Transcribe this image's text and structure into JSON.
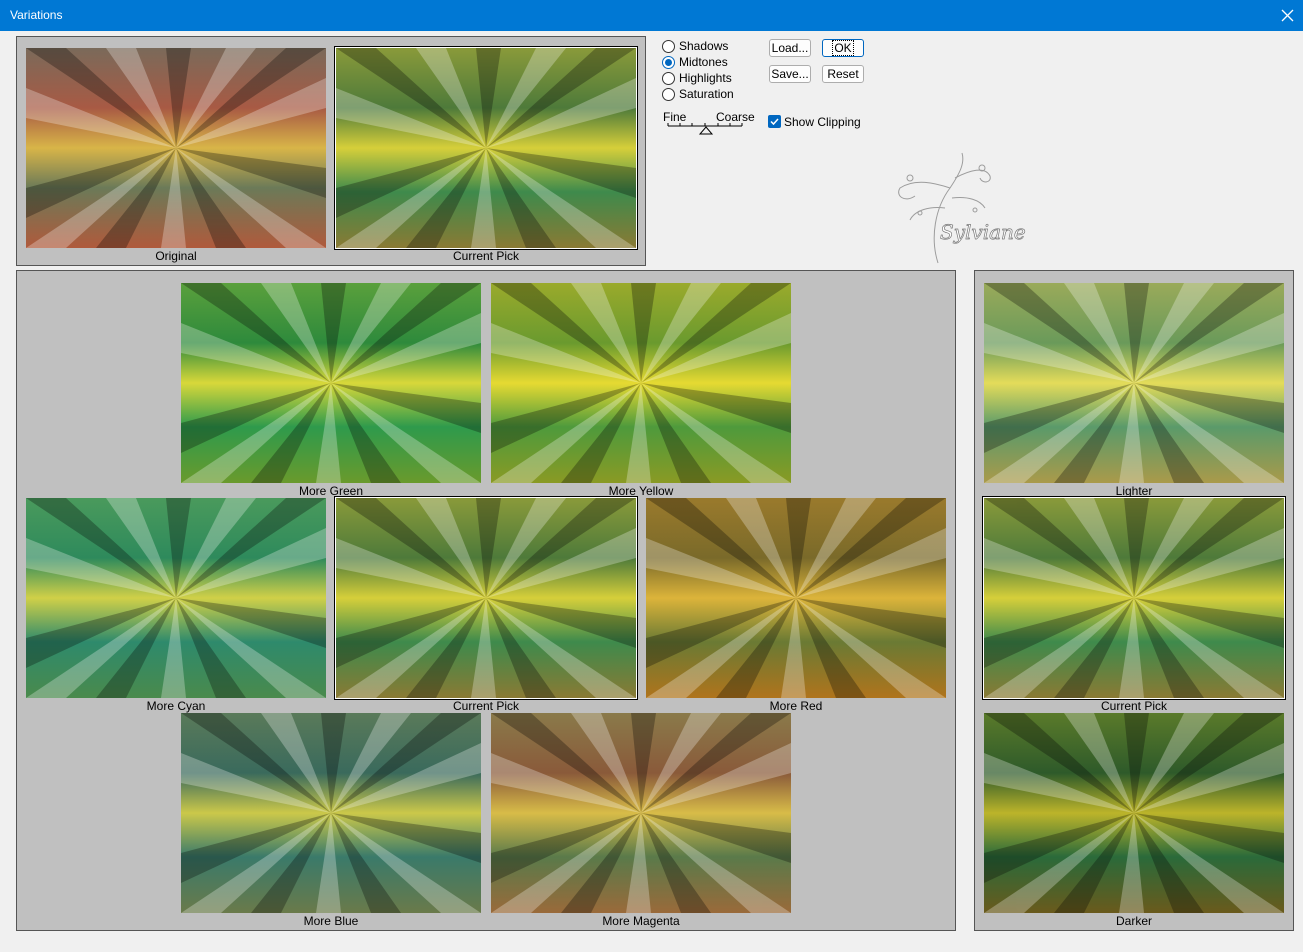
{
  "window": {
    "title": "Variations"
  },
  "top_thumbs": {
    "original": "Original",
    "current_pick": "Current Pick"
  },
  "tone_options": [
    {
      "label": "Shadows",
      "checked": false
    },
    {
      "label": "Midtones",
      "checked": true
    },
    {
      "label": "Highlights",
      "checked": false
    },
    {
      "label": "Saturation",
      "checked": false
    }
  ],
  "slider": {
    "left_label": "Fine",
    "right_label": "Coarse"
  },
  "buttons": {
    "load": "Load...",
    "ok": "OK",
    "save": "Save...",
    "reset": "Reset"
  },
  "show_clipping": {
    "label": "Show Clipping",
    "checked": true
  },
  "watermark": {
    "text": "Sylviane"
  },
  "color_variations": {
    "more_green": "More Green",
    "more_yellow": "More Yellow",
    "more_cyan": "More Cyan",
    "current_pick": "Current Pick",
    "more_red": "More Red",
    "more_blue": "More Blue",
    "more_magenta": "More Magenta"
  },
  "brightness_variations": {
    "lighter": "Lighter",
    "current_pick": "Current Pick",
    "darker": "Darker"
  },
  "icons": [
    "close-icon",
    "slider-thumb-icon",
    "checkmark-icon",
    "watermark-logo"
  ]
}
